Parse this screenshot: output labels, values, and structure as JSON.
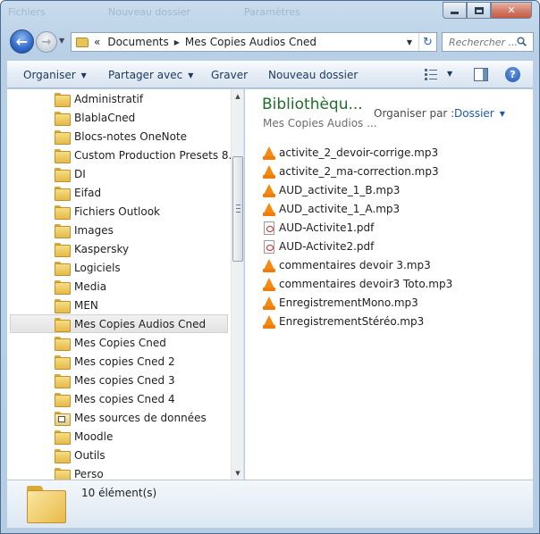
{
  "window": {
    "title_ghosts": [
      "Fichiers",
      "Nouveau dossier",
      "Paramètres"
    ]
  },
  "address_bar": {
    "overflow_marker": "«",
    "segments": [
      "Documents",
      "Mes Copies Audios Cned"
    ]
  },
  "search": {
    "placeholder": "Rechercher ..."
  },
  "toolbar": {
    "organize_label": "Organiser",
    "share_label": "Partager avec",
    "burn_label": "Graver",
    "new_folder_label": "Nouveau dossier",
    "help_label": "?"
  },
  "nav_tree": {
    "selected": "Mes Copies Audios Cned",
    "items": [
      {
        "label": "Administratif",
        "icon": "folder-icon"
      },
      {
        "label": "BlablaCned",
        "icon": "folder-icon"
      },
      {
        "label": "Blocs-notes OneNote",
        "icon": "folder-icon"
      },
      {
        "label": "Custom Production Presets 8.0",
        "icon": "folder-icon"
      },
      {
        "label": "DI",
        "icon": "folder-icon"
      },
      {
        "label": "Eifad",
        "icon": "folder-icon"
      },
      {
        "label": "Fichiers Outlook",
        "icon": "folder-icon"
      },
      {
        "label": "Images",
        "icon": "folder-icon"
      },
      {
        "label": "Kaspersky",
        "icon": "folder-icon"
      },
      {
        "label": "Logiciels",
        "icon": "folder-icon"
      },
      {
        "label": "Media",
        "icon": "folder-icon"
      },
      {
        "label": "MEN",
        "icon": "folder-icon"
      },
      {
        "label": "Mes Copies Audios Cned",
        "icon": "folder-icon"
      },
      {
        "label": "Mes Copies Cned",
        "icon": "folder-icon"
      },
      {
        "label": "Mes copies Cned 2",
        "icon": "folder-icon"
      },
      {
        "label": "Mes copies Cned 3",
        "icon": "folder-icon"
      },
      {
        "label": "Mes copies Cned 4",
        "icon": "folder-icon"
      },
      {
        "label": "Mes sources de données",
        "icon": "data-sources-folder-icon"
      },
      {
        "label": "Moodle",
        "icon": "folder-icon"
      },
      {
        "label": "Outils",
        "icon": "folder-icon"
      },
      {
        "label": "Perso",
        "icon": "folder-icon"
      }
    ]
  },
  "library": {
    "title": "Bibliothèqu...",
    "subtitle": "Mes Copies Audios ...",
    "arrange_label": "Organiser par :",
    "arrange_value": "Dossier"
  },
  "files": [
    {
      "name": "activite_2_devoir-corrige.mp3",
      "icon": "vlc-media-icon"
    },
    {
      "name": "activite_2_ma-correction.mp3",
      "icon": "vlc-media-icon"
    },
    {
      "name": "AUD_activite_1_B.mp3",
      "icon": "vlc-media-icon"
    },
    {
      "name": "AUD_activite_1_A.mp3",
      "icon": "vlc-media-icon"
    },
    {
      "name": "AUD-Activite1.pdf",
      "icon": "pdf-icon"
    },
    {
      "name": "AUD-Activite2.pdf",
      "icon": "pdf-icon"
    },
    {
      "name": "commentaires devoir 3.mp3",
      "icon": "vlc-media-icon"
    },
    {
      "name": "commentaires devoir3 Toto.mp3",
      "icon": "vlc-media-icon"
    },
    {
      "name": "EnregistrementMono.mp3",
      "icon": "vlc-media-icon"
    },
    {
      "name": "EnregistrementStéréo.mp3",
      "icon": "vlc-media-icon"
    }
  ],
  "details": {
    "count_text": "10 élément(s)"
  },
  "colors": {
    "library_title": "#1e6e2a",
    "link_blue": "#1e5aa8",
    "selection": "#e3e3e3",
    "vlc_orange": "#f28a14"
  }
}
